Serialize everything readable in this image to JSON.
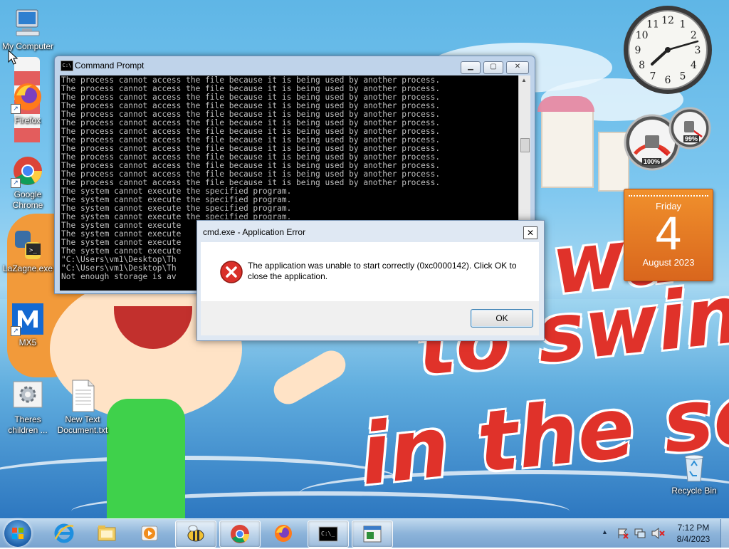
{
  "desktop": {
    "icons": [
      {
        "label": "My Computer"
      },
      {
        "label": "Firefox"
      },
      {
        "label": "Google Chrome"
      },
      {
        "label": "LaZagne.exe"
      },
      {
        "label": "MX5"
      },
      {
        "label": "Theres children ..."
      },
      {
        "label": "New Text Document.txt"
      },
      {
        "label": "Recycle Bin"
      }
    ],
    "wallpaper_text": {
      "line1": "wa",
      "line2": "to swin",
      "line3": "in the se"
    }
  },
  "cmd_window": {
    "title": "Command Prompt",
    "console_lines": [
      "The process cannot access the file because it is being used by another process.",
      "The process cannot access the file because it is being used by another process.",
      "The process cannot access the file because it is being used by another process.",
      "The process cannot access the file because it is being used by another process.",
      "The process cannot access the file because it is being used by another process.",
      "The process cannot access the file because it is being used by another process.",
      "The process cannot access the file because it is being used by another process.",
      "The process cannot access the file because it is being used by another process.",
      "The process cannot access the file because it is being used by another process.",
      "The process cannot access the file because it is being used by another process.",
      "The process cannot access the file because it is being used by another process.",
      "The process cannot access the file because it is being used by another process.",
      "The process cannot access the file because it is being used by another process.",
      "The system cannot execute the specified program.",
      "The system cannot execute the specified program.",
      "The system cannot execute the specified program.",
      "The system cannot execute the specified program.",
      "The system cannot execute",
      "The system cannot execute",
      "The system cannot execute",
      "The system cannot execute",
      "\"C:\\Users\\vm1\\Desktop\\Th",
      "\"C:\\Users\\vm1\\Desktop\\Th",
      "Not enough storage is av"
    ]
  },
  "error_dialog": {
    "title": "cmd.exe - Application Error",
    "message": "The application was unable to start correctly (0xc0000142). Click OK to close the application.",
    "ok_label": "OK",
    "close_label": "✕"
  },
  "gadgets": {
    "clock": {
      "numerals": [
        "12",
        "1",
        "2",
        "3",
        "4",
        "5",
        "6",
        "7",
        "8",
        "9",
        "10",
        "11"
      ]
    },
    "cpu_meter": {
      "cpu_label": "100%",
      "mem_label": "99%"
    },
    "calendar": {
      "weekday": "Friday",
      "day": "4",
      "month_year": "August 2023"
    }
  },
  "taskbar": {
    "time": "7:12 PM",
    "date": "8/4/2023",
    "show_hidden_label": "▲"
  },
  "colors": {
    "error_red": "#d9302a",
    "calendar_orange": "#e8782a",
    "console_bg": "#000000",
    "console_fg": "#c0c0c0"
  }
}
